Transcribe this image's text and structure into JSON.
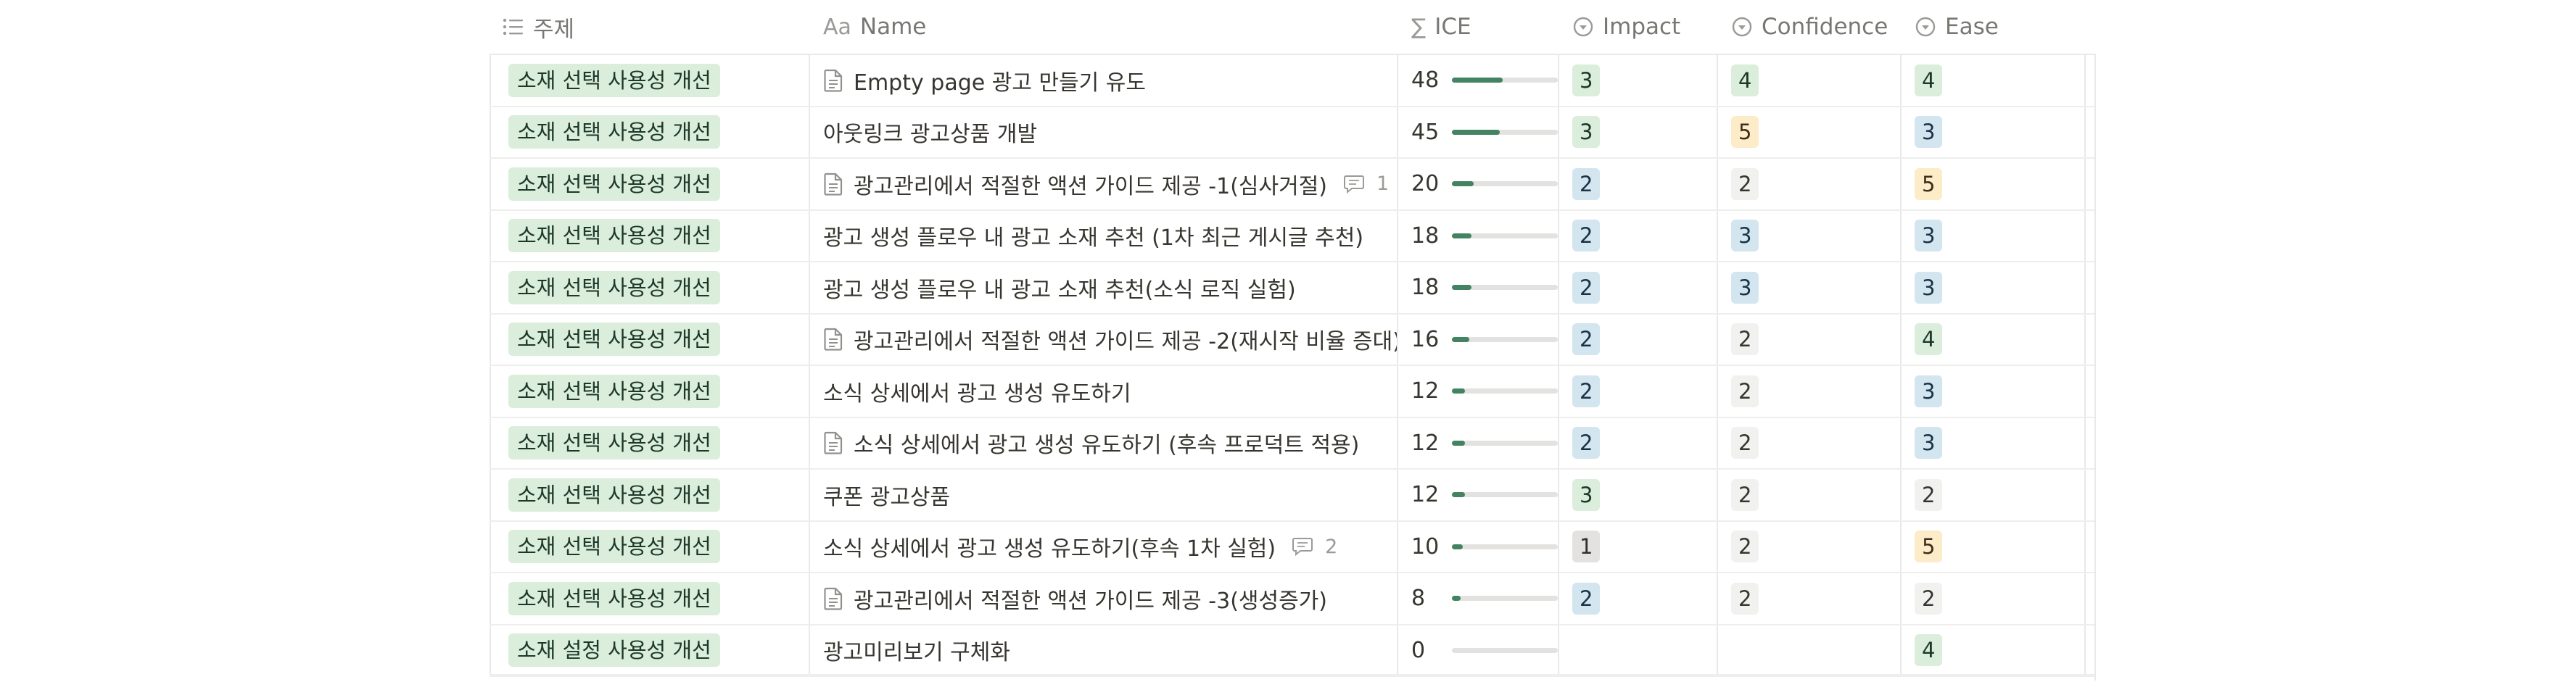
{
  "headers": {
    "topic": "주제",
    "name": "Name",
    "name_icon": "Aa",
    "ice": "ICE",
    "ice_icon": "∑",
    "impact": "Impact",
    "confidence": "Confidence",
    "ease": "Ease"
  },
  "colors": {
    "green": "#dbeddb",
    "blue": "#d3e5ef",
    "yellow": "#fdecc8",
    "gray": "#e3e2e0",
    "light": "#f1f1ef",
    "bar_fill": "#448361"
  },
  "rows": [
    {
      "topic": "소재 선택 사용성 개선",
      "name": "Empty page 광고 만들기 유도",
      "doc": true,
      "comments": "",
      "ice": "48",
      "ice_fill": 0.48,
      "impact": "3",
      "impact_color": "green",
      "confidence": "4",
      "confidence_color": "green",
      "ease": "4",
      "ease_color": "green"
    },
    {
      "topic": "소재 선택 사용성 개선",
      "name": "아웃링크 광고상품 개발",
      "doc": false,
      "comments": "",
      "ice": "45",
      "ice_fill": 0.45,
      "impact": "3",
      "impact_color": "green",
      "confidence": "5",
      "confidence_color": "yellow",
      "ease": "3",
      "ease_color": "blue"
    },
    {
      "topic": "소재 선택 사용성 개선",
      "name": "광고관리에서 적절한 액션 가이드 제공 -1(심사거절)",
      "doc": true,
      "comments": "1",
      "ice": "20",
      "ice_fill": 0.2,
      "impact": "2",
      "impact_color": "blue",
      "confidence": "2",
      "confidence_color": "light",
      "ease": "5",
      "ease_color": "yellow"
    },
    {
      "topic": "소재 선택 사용성 개선",
      "name": "광고 생성 플로우 내 광고 소재 추천 (1차 최근 게시글 추천)",
      "doc": false,
      "comments": "",
      "ice": "18",
      "ice_fill": 0.18,
      "impact": "2",
      "impact_color": "blue",
      "confidence": "3",
      "confidence_color": "blue",
      "ease": "3",
      "ease_color": "blue"
    },
    {
      "topic": "소재 선택 사용성 개선",
      "name": "광고 생성 플로우 내 광고 소재 추천(소식 로직 실험)",
      "doc": false,
      "comments": "",
      "ice": "18",
      "ice_fill": 0.18,
      "impact": "2",
      "impact_color": "blue",
      "confidence": "3",
      "confidence_color": "blue",
      "ease": "3",
      "ease_color": "blue"
    },
    {
      "topic": "소재 선택 사용성 개선",
      "name": "광고관리에서 적절한 액션 가이드 제공 -2(재시작 비율 증대)",
      "doc": true,
      "comments": "",
      "ice": "16",
      "ice_fill": 0.16,
      "impact": "2",
      "impact_color": "blue",
      "confidence": "2",
      "confidence_color": "light",
      "ease": "4",
      "ease_color": "green"
    },
    {
      "topic": "소재 선택 사용성 개선",
      "name": "소식 상세에서 광고 생성 유도하기",
      "doc": false,
      "comments": "",
      "ice": "12",
      "ice_fill": 0.12,
      "impact": "2",
      "impact_color": "blue",
      "confidence": "2",
      "confidence_color": "light",
      "ease": "3",
      "ease_color": "blue"
    },
    {
      "topic": "소재 선택 사용성 개선",
      "name": "소식 상세에서 광고 생성 유도하기 (후속 프로덕트 적용)",
      "doc": true,
      "comments": "",
      "ice": "12",
      "ice_fill": 0.12,
      "impact": "2",
      "impact_color": "blue",
      "confidence": "2",
      "confidence_color": "light",
      "ease": "3",
      "ease_color": "blue"
    },
    {
      "topic": "소재 선택 사용성 개선",
      "name": "쿠폰 광고상품",
      "doc": false,
      "comments": "",
      "ice": "12",
      "ice_fill": 0.12,
      "impact": "3",
      "impact_color": "green",
      "confidence": "2",
      "confidence_color": "light",
      "ease": "2",
      "ease_color": "light"
    },
    {
      "topic": "소재 선택 사용성 개선",
      "name": "소식 상세에서 광고 생성 유도하기(후속 1차 실험)",
      "doc": false,
      "comments": "2",
      "ice": "10",
      "ice_fill": 0.1,
      "impact": "1",
      "impact_color": "gray",
      "confidence": "2",
      "confidence_color": "light",
      "ease": "5",
      "ease_color": "yellow"
    },
    {
      "topic": "소재 선택 사용성 개선",
      "name": "광고관리에서 적절한 액션 가이드 제공 -3(생성증가)",
      "doc": true,
      "comments": "",
      "ice": "8",
      "ice_fill": 0.08,
      "impact": "2",
      "impact_color": "blue",
      "confidence": "2",
      "confidence_color": "light",
      "ease": "2",
      "ease_color": "light"
    },
    {
      "topic": "소재 설정 사용성 개선",
      "name": "광고미리보기 구체화",
      "doc": false,
      "comments": "",
      "ice": "0",
      "ice_fill": 0.0,
      "impact": "",
      "impact_color": "",
      "confidence": "",
      "confidence_color": "",
      "ease": "4",
      "ease_color": "green"
    }
  ]
}
